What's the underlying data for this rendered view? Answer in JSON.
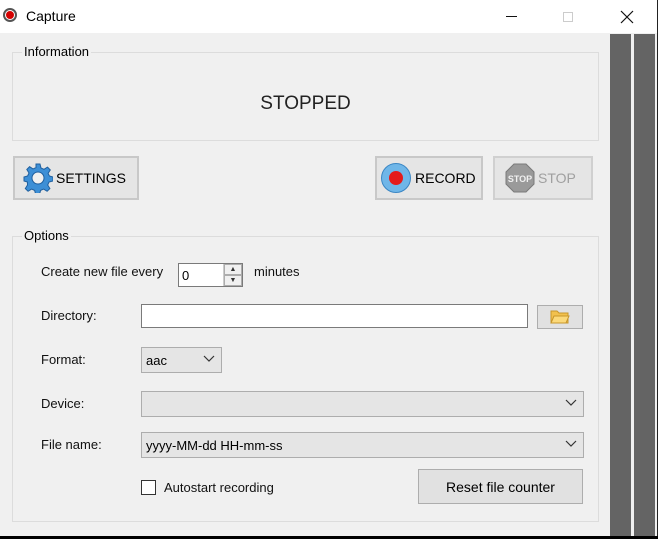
{
  "window": {
    "title": "Capture",
    "controls": {
      "minimize": "minimize",
      "maximize": "maximize",
      "close": "close"
    }
  },
  "information": {
    "group_label": "Information",
    "status": "STOPPED"
  },
  "toolbar": {
    "settings_label": "SETTINGS",
    "record_label": "RECORD",
    "stop_label": "STOP",
    "stop_icon_text": "STOP"
  },
  "options": {
    "group_label": "Options",
    "split_label": "Create new file every",
    "split_value": "0",
    "split_unit": "minutes",
    "directory_label": "Directory:",
    "directory_value": "",
    "format_label": "Format:",
    "format_value": "aac",
    "device_label": "Device:",
    "device_value": "",
    "filename_label": "File name:",
    "filename_value": "yyyy-MM-dd HH-mm-ss",
    "autostart_label": "Autostart recording",
    "autostart_checked": false,
    "reset_label": "Reset file counter"
  },
  "colors": {
    "record_red": "#e41b1b",
    "record_ring": "#6fb6e8",
    "level_meter": "#646464"
  }
}
